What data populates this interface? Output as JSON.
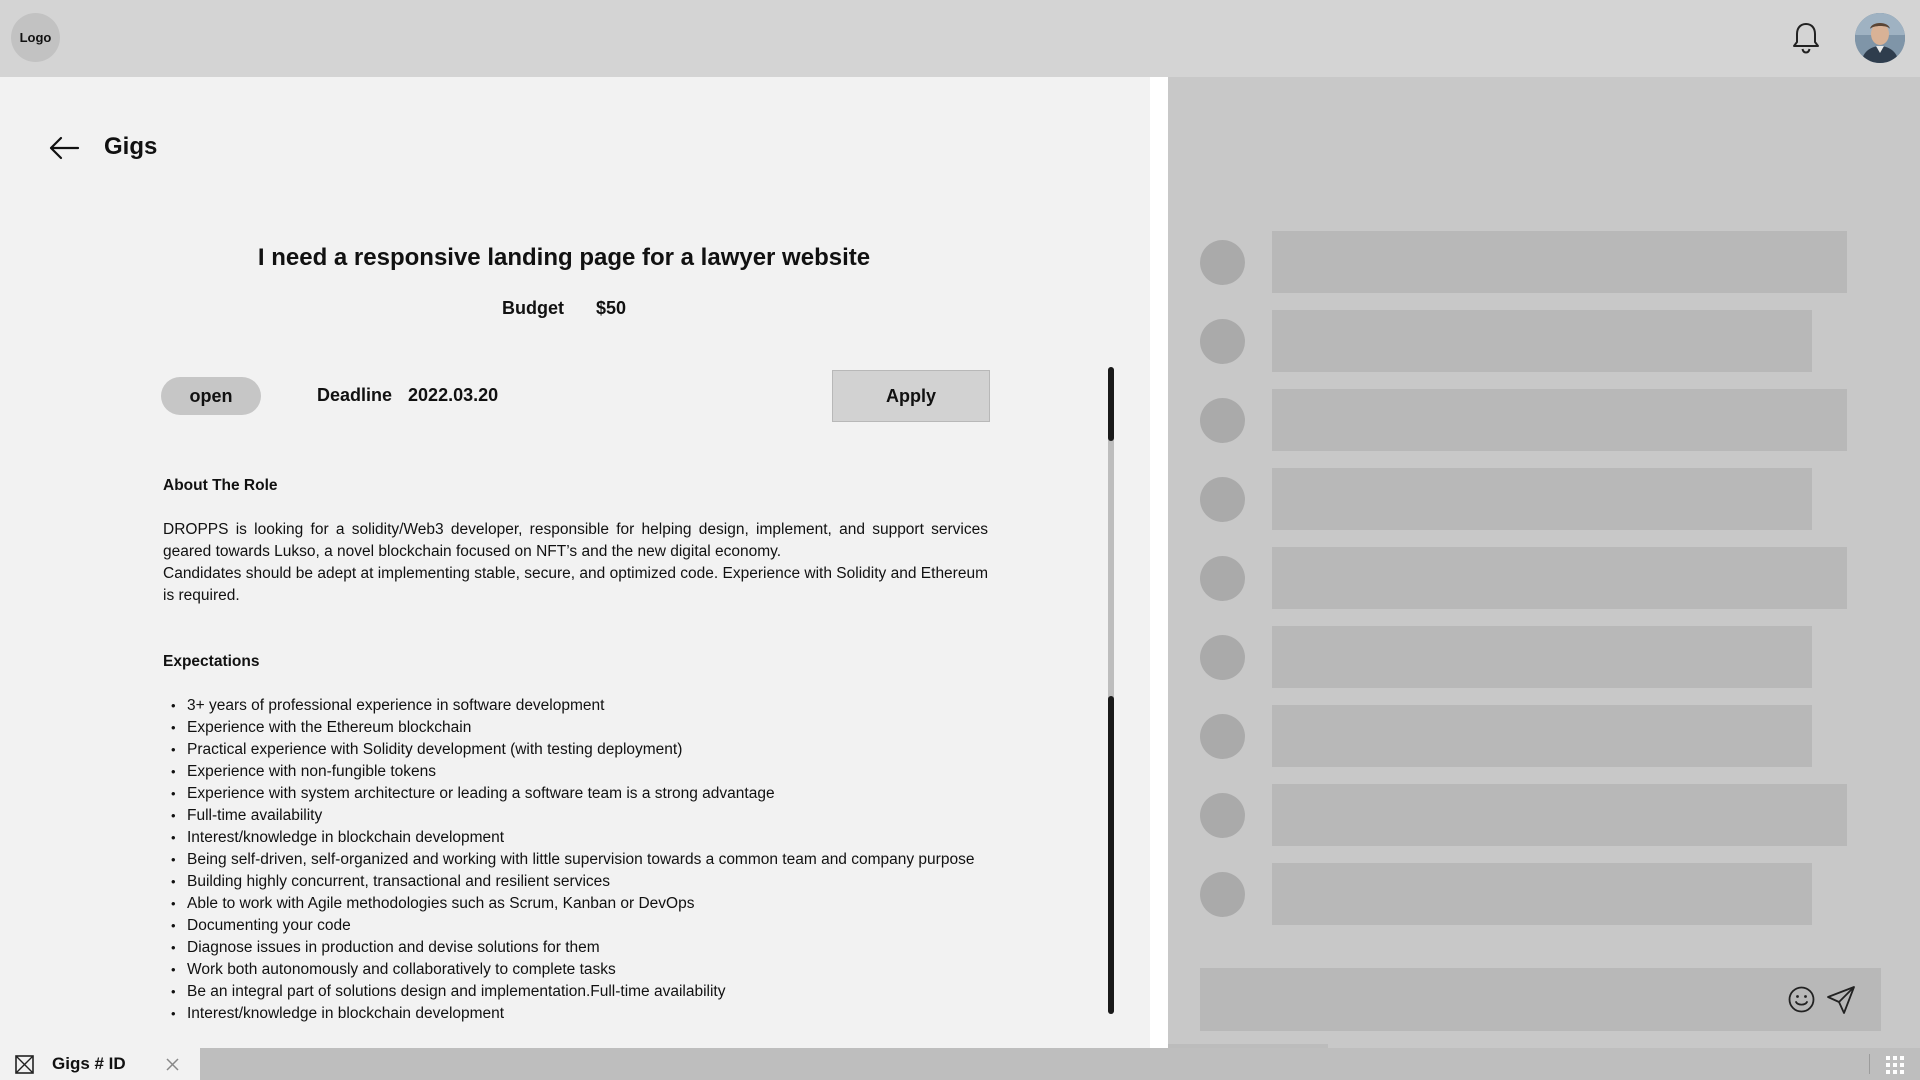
{
  "header": {
    "logo_text": "Logo",
    "notification_icon": "bell-icon",
    "avatar_icon": "user-avatar"
  },
  "page": {
    "title": "Gigs",
    "back_icon": "arrow-left-icon"
  },
  "gig": {
    "title": "I need a responsive landing page for a lawyer website",
    "budget_label": "Budget",
    "budget_value": "$50",
    "status": "open",
    "deadline_label": "Deadline",
    "deadline_value": "2022.03.20",
    "apply_label": "Apply"
  },
  "about": {
    "heading": "About The Role",
    "paragraph_1": "DROPPS is looking for a solidity/Web3 developer, responsible for helping design, implement, and support services geared towards Lukso, a novel blockchain focused on NFT’s and the new digital economy.",
    "paragraph_2": "Candidates should be adept at implementing stable, secure, and optimized code. Experience with Solidity and Ethereum is required."
  },
  "expectations": {
    "heading": "Expectations",
    "items": [
      "3+ years of professional experience in software development",
      "Experience with the Ethereum blockchain",
      "Practical experience with Solidity development (with testing deployment)",
      "Experience with non-fungible tokens",
      "Experience with system architecture or leading a software team is a strong advantage",
      "Full-time availability",
      "Interest/knowledge in blockchain development",
      "Being self-driven, self-organized and working with little supervision towards a common team and company purpose",
      "Building highly concurrent, transactional and resilient services",
      "Able to work with Agile methodologies such as Scrum, Kanban or DevOps",
      "Documenting your code",
      "Diagnose issues in production and devise solutions for them",
      "Work both autonomously and collaboratively to complete tasks",
      "Be an integral part of solutions design and implementation.Full-time availability",
      "Interest/knowledge in blockchain development"
    ]
  },
  "chat": {
    "emoji_icon": "emoji-icon",
    "send_icon": "send-icon"
  },
  "taskbar": {
    "tab_label": "Gigs # ID",
    "tab_icon": "image-placeholder-icon",
    "close_icon": "close-icon",
    "apps_icon": "grid-icon"
  },
  "colors": {
    "topbar": "#d4d4d4",
    "background": "#f2f2f2",
    "chat_panel": "#c8c8c8",
    "placeholder": "#b8b8b8"
  }
}
